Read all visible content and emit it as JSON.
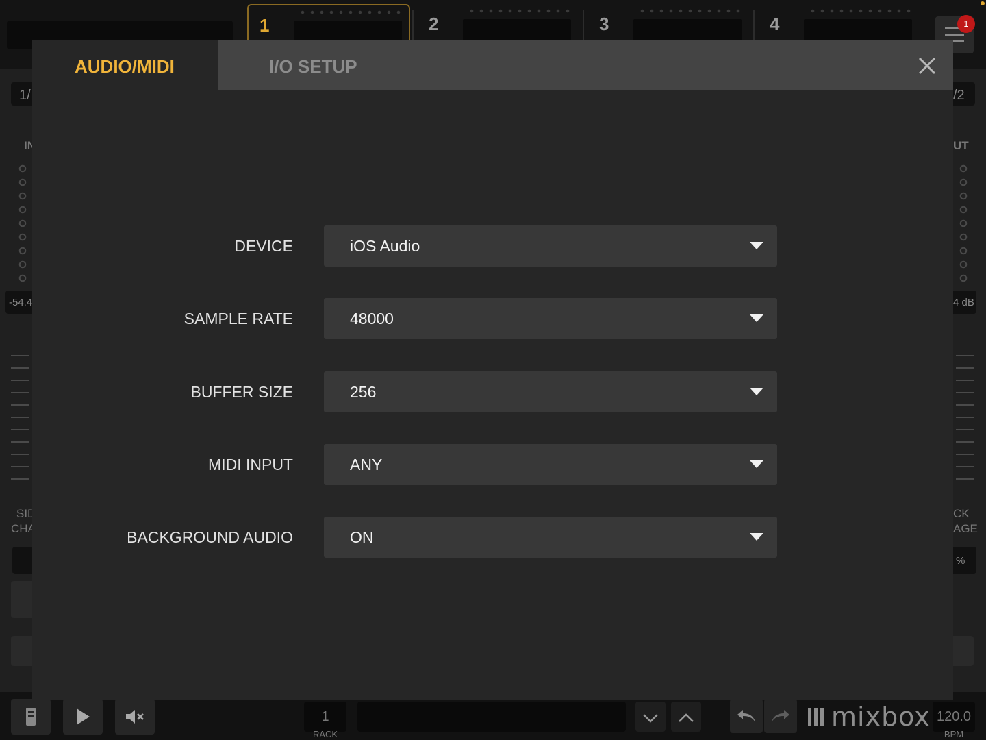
{
  "top": {
    "slots": [
      {
        "label": "1",
        "active": true
      },
      {
        "label": "2",
        "active": false
      },
      {
        "label": "3",
        "active": false
      },
      {
        "label": "4",
        "active": false
      }
    ],
    "notification_count": "1"
  },
  "background": {
    "left_page": "1/",
    "right_page": "/2",
    "left_header": "IN",
    "right_header": "UT",
    "left_level": "-54.4",
    "right_level": "4 dB",
    "left_label_1": "SID",
    "left_label_2": "CHA",
    "right_label_1": "CK",
    "right_label_2": "AGE",
    "right_percent": "%"
  },
  "bottom": {
    "rack_number": "1",
    "rack_label": "RACK",
    "logo_text": "mixbox",
    "bpm_value": "120.0",
    "bpm_label": "BPM"
  },
  "modal": {
    "tabs": {
      "audio_midi": "AUDIO/MIDI",
      "io_setup": "I/O SETUP"
    },
    "close_symbol": "✕",
    "settings": [
      {
        "label": "DEVICE",
        "value": "iOS Audio"
      },
      {
        "label": "SAMPLE RATE",
        "value": "48000"
      },
      {
        "label": "BUFFER SIZE",
        "value": "256"
      },
      {
        "label": "MIDI INPUT",
        "value": "ANY"
      },
      {
        "label": "BACKGROUND AUDIO",
        "value": "ON"
      }
    ]
  },
  "colors": {
    "accent": "#f0b43a",
    "modal_bg": "#262626",
    "tabbar_bg": "#444444",
    "select_bg": "#383838",
    "badge": "#c01818"
  },
  "icons": [
    "hamburger-menu-icon",
    "close-icon",
    "chevron-down-icon",
    "mobile-icon",
    "play-icon",
    "mute-icon",
    "undo-icon",
    "redo-icon"
  ]
}
